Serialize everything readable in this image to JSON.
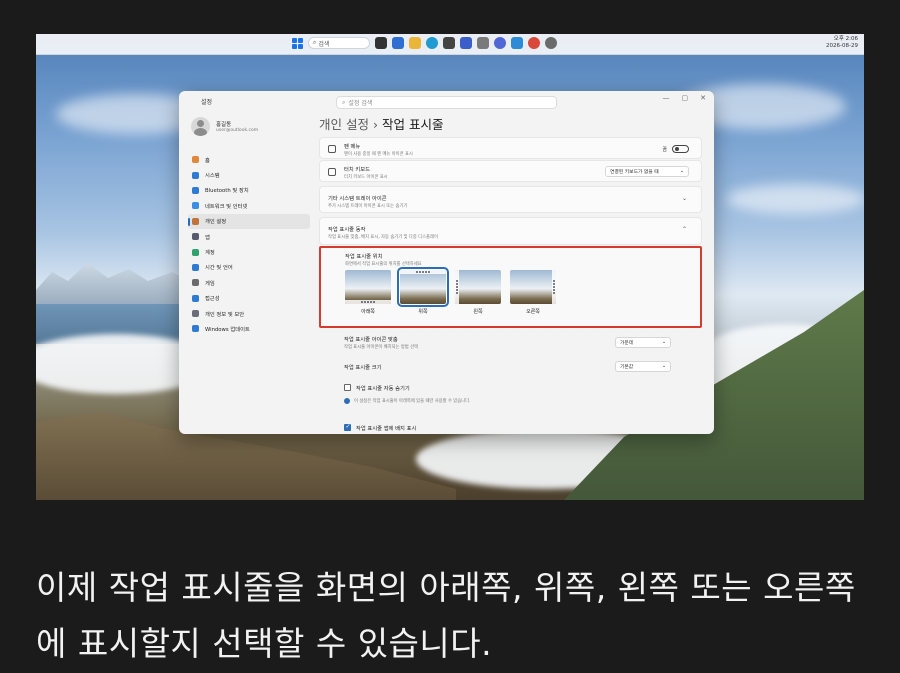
{
  "taskbar": {
    "search_placeholder": "검색",
    "clock_time": "오후 2:06",
    "clock_date": "2026-08-29"
  },
  "window": {
    "title": "설정",
    "search_placeholder": "설정 검색",
    "controls": [
      "—",
      "▢",
      "✕"
    ]
  },
  "profile": {
    "name": "홍길동",
    "email": "user@outlook.com"
  },
  "nav": {
    "items": [
      {
        "label": "홈",
        "color": "#e0893a"
      },
      {
        "label": "시스템",
        "color": "#2f7bd2"
      },
      {
        "label": "Bluetooth 및 장치",
        "color": "#2f7bd2"
      },
      {
        "label": "네트워크 및 인터넷",
        "color": "#3a8ee6"
      },
      {
        "label": "개인 설정",
        "color": "#c0733a"
      },
      {
        "label": "앱",
        "color": "#5a5a6e"
      },
      {
        "label": "계정",
        "color": "#2fa36b"
      },
      {
        "label": "시간 및 언어",
        "color": "#2f7bd2"
      },
      {
        "label": "게임",
        "color": "#6b6b6b"
      },
      {
        "label": "접근성",
        "color": "#2f7bd2"
      },
      {
        "label": "개인 정보 및 보안",
        "color": "#6b6b7a"
      },
      {
        "label": "Windows 업데이트",
        "color": "#2f7bd2"
      }
    ]
  },
  "breadcrumb": {
    "parent": "개인 설정",
    "separator": "›",
    "current": "작업 표시줄"
  },
  "settings": {
    "pen_menu": {
      "title": "펜 메뉴",
      "sub": "펜이 사용 중일 때 펜 메뉴 아이콘 표시",
      "toggle_label": "끔"
    },
    "touch_keyboard": {
      "title": "터치 키보드",
      "sub": "터치 키보드 아이콘 표시",
      "dropdown": "연결된 키보드가 없을 때"
    },
    "tray_icons": {
      "title": "기타 시스템 트레이 아이콘",
      "sub": "추가 시스템 트레이 아이콘 표시 또는 숨기기"
    },
    "behaviors": {
      "title": "작업 표시줄 동작",
      "sub": "작업 표시줄 맞춤, 배지 표시, 자동 숨기기 및 다중 디스플레이"
    },
    "position": {
      "title": "작업 표시줄 위치",
      "sub": "화면에서 작업 표시줄의 위치를 선택하세요",
      "options": [
        "아래쪽",
        "위쪽",
        "왼쪽",
        "오른쪽"
      ],
      "selected": "위쪽"
    },
    "alignment": {
      "title": "작업 표시줄 아이콘 맞춤",
      "sub": "작업 표시줄 아이콘이 배치되는 방법 선택",
      "dropdown": "가운데"
    },
    "size": {
      "title": "작업 표시줄 크기",
      "dropdown": "기본값"
    },
    "auto_hide": {
      "label": "작업 표시줄 자동 숨기기",
      "checked": false
    },
    "info_note": "이 설정은 작업 표시줄이 아래쪽에 있을 때만 사용할 수 있습니다.",
    "badges": {
      "label": "작업 표시줄 앱에 배지 표시",
      "checked": true
    }
  },
  "accent_color": "#2d6db5",
  "highlight_color": "#d63b2f",
  "caption": "이제 작업 표시줄을 화면의 아래쪽, 위쪽, 왼쪽 또는 오른쪽에 표시할지 선택할 수 있습니다."
}
